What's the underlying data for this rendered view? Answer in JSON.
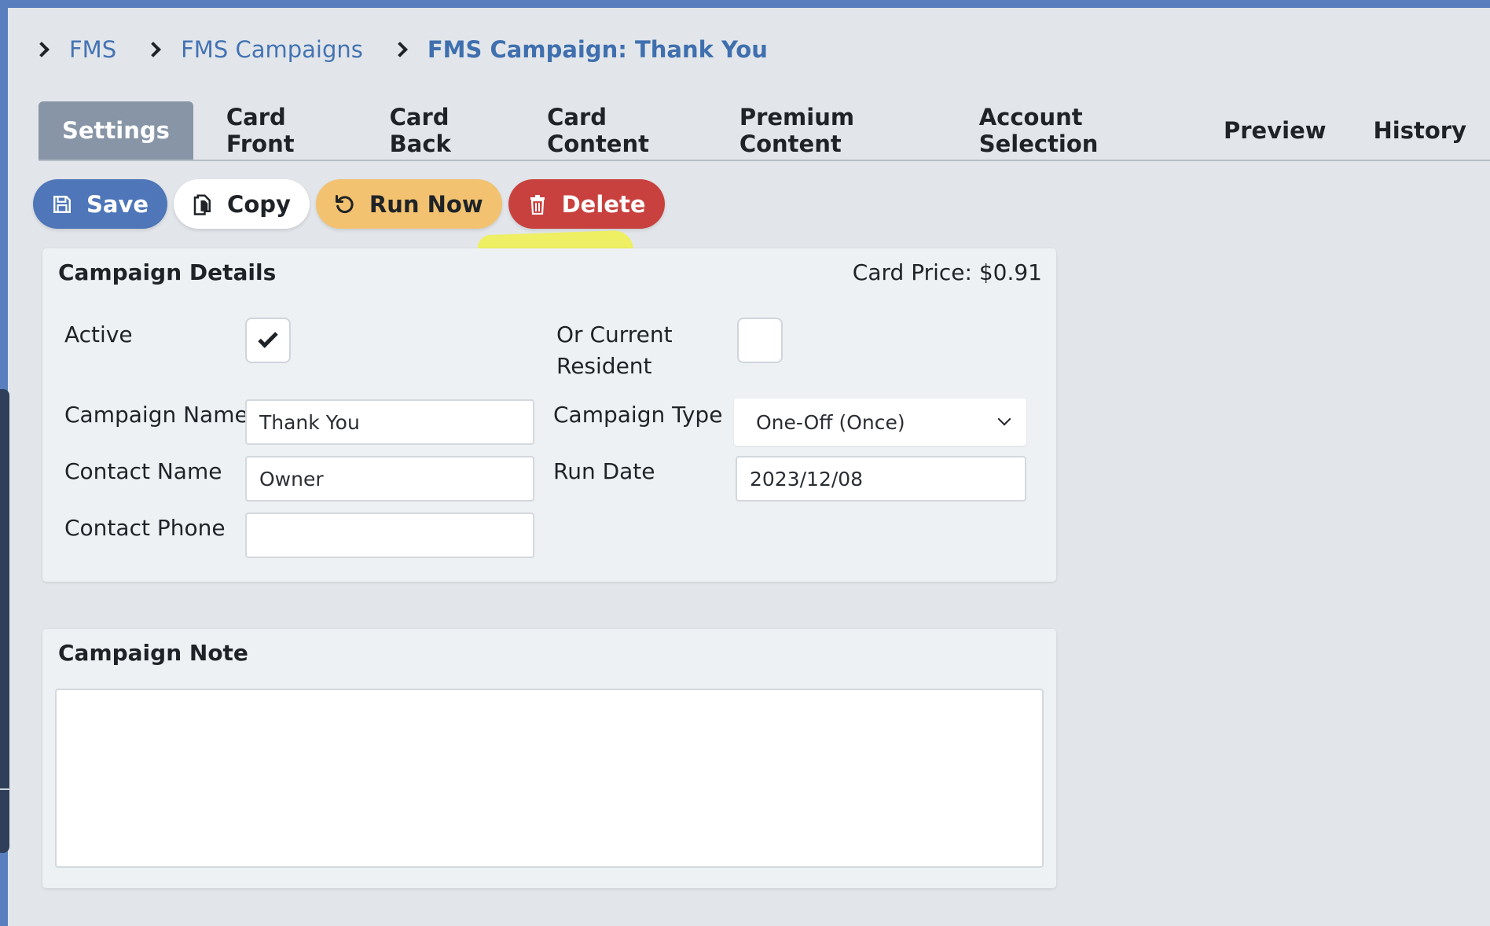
{
  "breadcrumb": {
    "items": [
      {
        "label": "FMS"
      },
      {
        "label": "FMS Campaigns"
      },
      {
        "label": "FMS Campaign: Thank You"
      }
    ]
  },
  "tabs": [
    {
      "label": "Settings",
      "active": true
    },
    {
      "label": "Card Front"
    },
    {
      "label": "Card Back"
    },
    {
      "label": "Card Content"
    },
    {
      "label": "Premium Content"
    },
    {
      "label": "Account Selection"
    },
    {
      "label": "Preview"
    },
    {
      "label": "History"
    }
  ],
  "actions": {
    "save": "Save",
    "copy": "Copy",
    "run_now": "Run Now",
    "delete": "Delete"
  },
  "details": {
    "title": "Campaign Details",
    "card_price": "Card Price: $0.91",
    "active_label": "Active",
    "active_checked": true,
    "or_current_resident_line1": "Or Current",
    "or_current_resident_line2": "Resident",
    "or_current_resident_checked": false,
    "campaign_name_label": "Campaign Name",
    "campaign_name_value": "Thank You",
    "campaign_type_label": "Campaign Type",
    "campaign_type_value": "One-Off (Once)",
    "contact_name_label": "Contact Name",
    "contact_name_value": "Owner",
    "run_date_label": "Run Date",
    "run_date_value": "2023/12/08",
    "contact_phone_label": "Contact Phone",
    "contact_phone_value": ""
  },
  "note": {
    "title": "Campaign Note",
    "value": ""
  },
  "colors": {
    "save": "#4e76b8",
    "run_now": "#f2c270",
    "delete": "#c8413f",
    "active_tab": "#8795a6",
    "link": "#4473b3",
    "highlight": "#f0f04a"
  }
}
